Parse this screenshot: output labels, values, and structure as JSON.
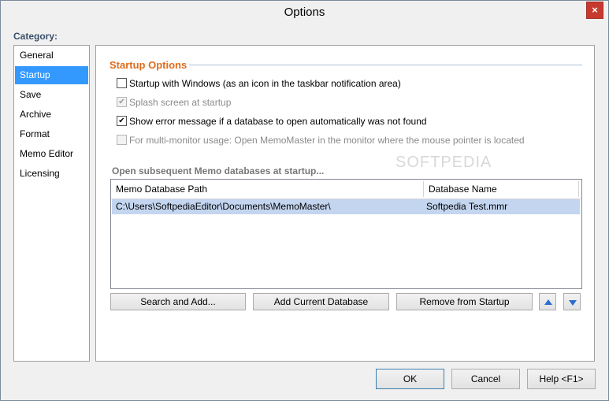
{
  "window": {
    "title": "Options",
    "close_glyph": "×"
  },
  "category": {
    "label": "Category:",
    "items": [
      {
        "label": "General",
        "selected": false
      },
      {
        "label": "Startup",
        "selected": true
      },
      {
        "label": "Save",
        "selected": false
      },
      {
        "label": "Archive",
        "selected": false
      },
      {
        "label": "Format",
        "selected": false
      },
      {
        "label": "Memo Editor",
        "selected": false
      },
      {
        "label": "Licensing",
        "selected": false
      }
    ]
  },
  "startup": {
    "section_title": "Startup Options",
    "options": [
      {
        "label": "Startup with Windows (as an icon in the taskbar notification area)",
        "checked": false,
        "disabled": false
      },
      {
        "label": "Splash screen at startup",
        "checked": true,
        "disabled": true
      },
      {
        "label": "Show error message if a database to open automatically was not found",
        "checked": true,
        "disabled": false
      },
      {
        "label": "For multi-monitor usage: Open MemoMaster in the monitor where the mouse pointer is located",
        "checked": false,
        "disabled": true
      }
    ],
    "subsequent_heading": "Open subsequent Memo databases at startup...",
    "grid": {
      "columns": [
        "Memo Database Path",
        "Database Name"
      ],
      "rows": [
        {
          "path": "C:\\Users\\SoftpediaEditor\\Documents\\MemoMaster\\",
          "name": "Softpedia Test.mmr"
        }
      ]
    },
    "buttons": {
      "search_add": "Search and Add...",
      "add_current": "Add Current Database",
      "remove": "Remove from Startup"
    }
  },
  "footer": {
    "ok": "OK",
    "cancel": "Cancel",
    "help": "Help <F1>"
  },
  "watermark": "SOFTPEDIA",
  "colors": {
    "accent": "#e06b1a",
    "selection": "#3399ff",
    "row_highlight": "#c3d5ef",
    "close": "#c7392e"
  }
}
